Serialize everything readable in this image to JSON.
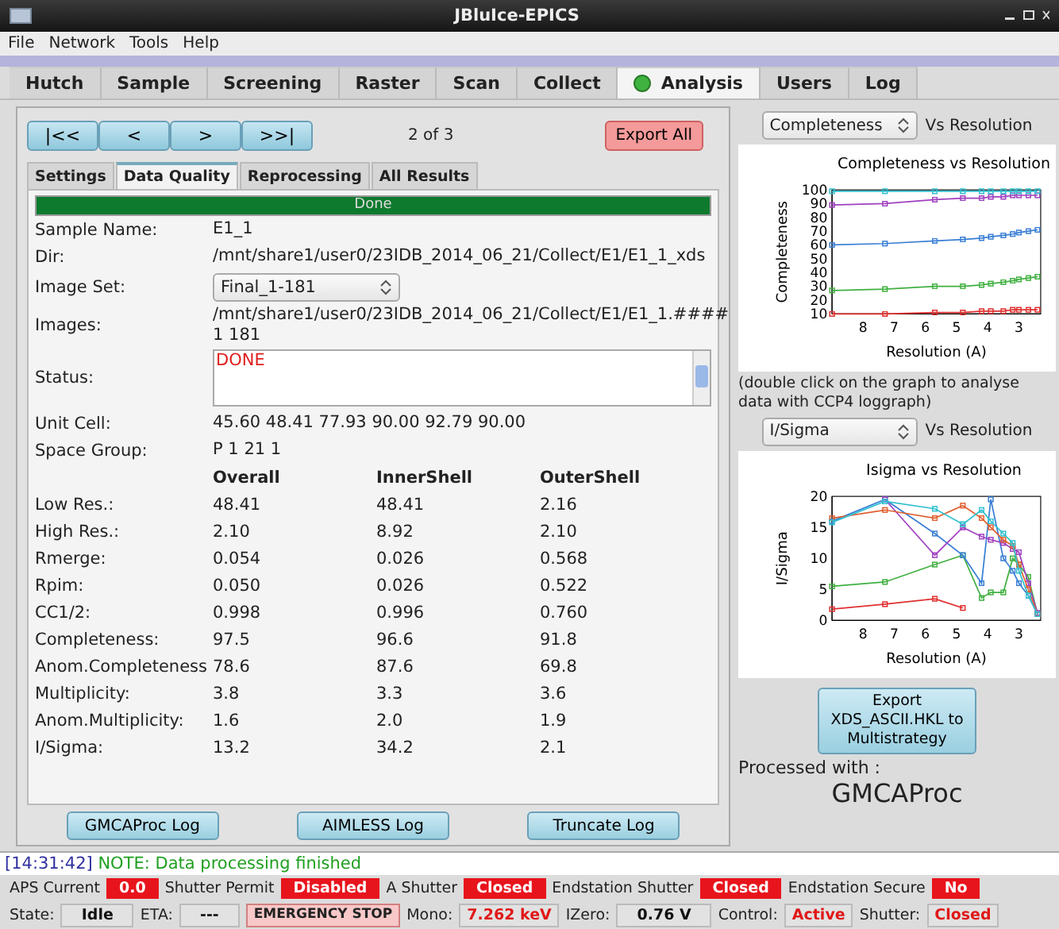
{
  "window": {
    "title": "JBluIce-EPICS"
  },
  "menu": [
    "File",
    "Network",
    "Tools",
    "Help"
  ],
  "tabs": [
    {
      "label": "Hutch",
      "selected": false,
      "indicator": false
    },
    {
      "label": "Sample",
      "selected": false,
      "indicator": false
    },
    {
      "label": "Screening",
      "selected": false,
      "indicator": false
    },
    {
      "label": "Raster",
      "selected": false,
      "indicator": false
    },
    {
      "label": "Scan",
      "selected": false,
      "indicator": false
    },
    {
      "label": "Collect",
      "selected": false,
      "indicator": false
    },
    {
      "label": "Analysis",
      "selected": true,
      "indicator": true
    },
    {
      "label": "Users",
      "selected": false,
      "indicator": false
    },
    {
      "label": "Log",
      "selected": false,
      "indicator": false
    }
  ],
  "navigation": {
    "buttons": [
      "|<<",
      "<",
      ">",
      ">>|"
    ],
    "position": "2 of 3",
    "export": "Export All"
  },
  "subtabs": [
    {
      "label": "Settings",
      "selected": false
    },
    {
      "label": "Data Quality",
      "selected": true
    },
    {
      "label": "Reprocessing",
      "selected": false
    },
    {
      "label": "All Results",
      "selected": false
    }
  ],
  "progress": {
    "label": "Done",
    "level": 1
  },
  "details": [
    {
      "kind": "text",
      "label": "Sample Name:",
      "value": "E1_1"
    },
    {
      "kind": "text",
      "label": "Dir:",
      "value": "/mnt/share1/user0/23IDB_2014_06_21/Collect/E1/E1_1_xds"
    },
    {
      "kind": "select",
      "label": "Image Set:",
      "value": "Final_1-181"
    },
    {
      "kind": "text",
      "label": "Images:",
      "value": "/mnt/share1/user0/23IDB_2014_06_21/Collect/E1/E1_1.#### 1 181"
    },
    {
      "kind": "textarea",
      "label": "Status:",
      "value": "DONE"
    },
    {
      "kind": "text",
      "label": "Unit Cell:",
      "value": "45.60  48.41 77.93 90.00 92.79 90.00"
    },
    {
      "kind": "text",
      "label": "Space Group:",
      "value": "P 1 21 1"
    }
  ],
  "statistics": {
    "columns": [
      "Overall",
      "InnerShell",
      "OuterShell"
    ],
    "rows": [
      {
        "label": "Low Res.:",
        "values": [
          "48.41",
          "48.41",
          "2.16"
        ]
      },
      {
        "label": "High Res.:",
        "values": [
          "2.10",
          "8.92",
          "2.10"
        ]
      },
      {
        "label": "Rmerge:",
        "values": [
          "0.054",
          "0.026",
          "0.568"
        ]
      },
      {
        "label": "Rpim:",
        "values": [
          "0.050",
          "0.026",
          "0.522"
        ]
      },
      {
        "label": "CC1/2:",
        "values": [
          "0.998",
          "0.996",
          "0.760"
        ]
      },
      {
        "label": "Completeness:",
        "values": [
          "97.5",
          "96.6",
          "91.8"
        ]
      },
      {
        "label": "Anom.Completeness",
        "values": [
          "78.6",
          "87.6",
          "69.8"
        ]
      },
      {
        "label": "Multiplicity:",
        "values": [
          "3.8",
          "3.3",
          "3.6"
        ]
      },
      {
        "label": "Anom.Multiplicity:",
        "values": [
          "1.6",
          "2.0",
          "1.9"
        ]
      },
      {
        "label": "I/Sigma:",
        "values": [
          "13.2",
          "34.2",
          "2.1"
        ]
      }
    ]
  },
  "log_buttons": [
    "GMCAProc Log",
    "AIMLESS Log",
    "Truncate Log"
  ],
  "plots": [
    {
      "selector": "Completeness",
      "suffix": "Vs Resolution",
      "chart_data": {
        "type": "line",
        "title": "Completeness vs Resolution",
        "xlabel": "Resolution (A)",
        "ylabel": "Completeness",
        "x": [
          9,
          7.3,
          5.7,
          4.8,
          4.2,
          3.9,
          3.5,
          3.2,
          3.0,
          2.7,
          2.4
        ],
        "xlim": [
          9,
          2.3
        ],
        "ylim": [
          10,
          100
        ],
        "xticks": [
          8,
          7,
          6,
          5,
          4,
          3
        ],
        "yticks": [
          10,
          20,
          30,
          40,
          50,
          60,
          70,
          80,
          90,
          100
        ],
        "series": [
          {
            "color": "#e03030",
            "values": [
              10,
              10,
              11,
              11,
              12,
              12,
              12,
              13,
              13,
              13,
              13
            ]
          },
          {
            "color": "#40b040",
            "values": [
              27,
              28,
              30,
              30,
              31,
              32,
              33,
              34,
              35,
              36,
              37
            ]
          },
          {
            "color": "#3a7fd5",
            "values": [
              60,
              61,
              63,
              64,
              65,
              66,
              67,
              68,
              69,
              70,
              71
            ]
          },
          {
            "color": "#a040c0",
            "values": [
              89,
              90,
              93,
              94,
              94,
              95,
              95,
              96,
              96,
              96,
              96
            ]
          },
          {
            "color": "#30c0d0",
            "values": [
              99,
              99,
              99,
              99,
              99,
              99,
              99,
              99,
              99,
              99,
              99
            ]
          }
        ]
      }
    },
    {
      "selector": "I/Sigma",
      "suffix": "Vs Resolution",
      "chart_data": {
        "type": "line",
        "title": "Isigma vs Resolution",
        "xlabel": "Resolution (A)",
        "ylabel": "I/Sigma",
        "x": [
          9,
          7.3,
          5.7,
          4.8,
          4.2,
          3.9,
          3.5,
          3.2,
          3.0,
          2.7,
          2.4
        ],
        "xlim": [
          9,
          2.3
        ],
        "ylim": [
          0,
          20
        ],
        "xticks": [
          8,
          7,
          6,
          5,
          4,
          3
        ],
        "yticks": [
          0,
          5,
          10,
          15,
          20
        ],
        "series": [
          {
            "color": "#e03030",
            "values": [
              1.8,
              2.6,
              3.5,
              2,
              null,
              null,
              null,
              null,
              null,
              null,
              null
            ]
          },
          {
            "color": "#40b040",
            "values": [
              5.5,
              6.2,
              9,
              10.5,
              3.6,
              4.5,
              4.5,
              10,
              9,
              7,
              1
            ]
          },
          {
            "color": "#3a7fd5",
            "values": [
              16,
              19.5,
              14,
              10.5,
              6,
              19.5,
              10,
              8,
              6,
              4,
              1
            ]
          },
          {
            "color": "#a040c0",
            "values": [
              null,
              19.5,
              10.5,
              15,
              13.5,
              13,
              12.5,
              11.5,
              11,
              6,
              1.2
            ]
          },
          {
            "color": "#e06030",
            "values": [
              16.5,
              17.8,
              16.5,
              18.5,
              16.5,
              15,
              13,
              12,
              9,
              5,
              1
            ]
          },
          {
            "color": "#30c0d0",
            "values": [
              15.8,
              19.2,
              18,
              15.5,
              17.8,
              16,
              14,
              12.5,
              8,
              4,
              1
            ]
          }
        ]
      }
    }
  ],
  "plot_note": "(double click on the graph to analyse data with CCP4 loggraph)",
  "export_button": "Export XDS_ASCII.HKL to Multistrategy",
  "processed": {
    "label": "Processed with :",
    "value": "GMCAProc"
  },
  "log": {
    "time": "[14:31:42]",
    "message": "NOTE: Data processing finished"
  },
  "status_rows": [
    [
      {
        "label": "APS Current",
        "value": "0.0",
        "kind": "alarm"
      },
      {
        "label": "Shutter Permit",
        "value": "Disabled",
        "kind": "alarm"
      },
      {
        "label": "A Shutter",
        "value": "Closed",
        "kind": "alarm"
      },
      {
        "label": "Endstation Shutter",
        "value": "Closed",
        "kind": "alarm"
      },
      {
        "label": "Endstation Secure",
        "value": "No",
        "kind": "alarm"
      }
    ],
    [
      {
        "label": "State:",
        "value": "Idle",
        "kind": "plain"
      },
      {
        "label": "ETA:",
        "value": "---",
        "kind": "plain"
      },
      {
        "value": "EMERGENCY STOP",
        "kind": "button"
      },
      {
        "label": "Mono:",
        "value": "7.262 keV",
        "kind": "alert"
      },
      {
        "label": "IZero:",
        "value": "0.76 V",
        "kind": "plain"
      },
      {
        "label": "Control:",
        "value": "Active",
        "kind": "alert"
      },
      {
        "label": "Shutter:",
        "value": "Closed",
        "kind": "alert"
      }
    ]
  ]
}
